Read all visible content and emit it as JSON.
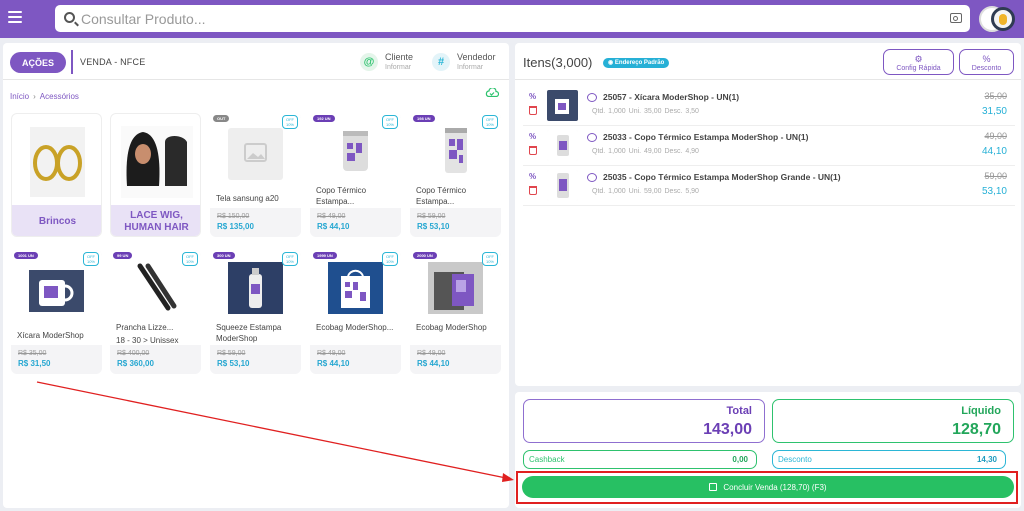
{
  "topbar": {
    "search_placeholder": "Consultar Produto..."
  },
  "left": {
    "acoes": "AÇÕES",
    "venda_type": "VENDA - NFCE",
    "cliente_label": "Cliente",
    "cliente_sub": "Informar",
    "vendedor_label": "Vendedor",
    "vendedor_sub": "Informar",
    "breadcrumb_home": "Início",
    "breadcrumb_sep": "›",
    "breadcrumb_current": "Acessórios",
    "categories": [
      {
        "name": "Brincos"
      },
      {
        "name_line1": "LACE WIG,",
        "name_line2": "HUMAN HAIR"
      }
    ],
    "products": [
      {
        "badge": "OUT",
        "off": "OFF 10%",
        "name": "Tela sansung a20",
        "old": "R$ 150,00",
        "price": "R$ 135,00"
      },
      {
        "badge": "192 UN",
        "off": "OFF 10%",
        "name": "Copo Térmico Estampa...",
        "old": "R$ 49,00",
        "price": "R$ 44,10"
      },
      {
        "badge": "198 UN",
        "off": "OFF 10%",
        "name": "Copo Térmico Estampa...",
        "old": "R$ 59,00",
        "price": "R$ 53,10"
      },
      {
        "badge": "1001 UN",
        "off": "OFF 10%",
        "name": "Xícara ModerShop",
        "old": "R$ 35,00",
        "price": "R$ 31,50"
      },
      {
        "badge": "99 UN",
        "off": "OFF 10%",
        "name": "Prancha Lizze...",
        "name2": "18 - 30 > Unissex",
        "old": "R$ 400,00",
        "price": "R$ 360,00"
      },
      {
        "badge": "300 UN",
        "off": "OFF 10%",
        "name": "Squeeze Estampa ModerShop",
        "old": "R$ 59,00",
        "price": "R$ 53,10"
      },
      {
        "badge": "1999 UN",
        "off": "OFF 10%",
        "name": "Ecobag ModerShop...",
        "old": "R$ 49,00",
        "price": "R$ 44,10"
      },
      {
        "badge": "2000 UN",
        "off": "OFF 10%",
        "name": "Ecobag ModerShop",
        "old": "R$ 49,00",
        "price": "R$ 44,10"
      }
    ]
  },
  "right": {
    "title": "Itens(3,000)",
    "address_badge": "Endereço Padrão",
    "config_label": "Config Rápida",
    "desconto_label": "Desconto",
    "items": [
      {
        "title": "25057 - Xícara ModerShop - UN(1)",
        "meta": "Qtd. 1,000  Uni. 35,00  Desc. 3,50",
        "old": "35,00",
        "price": "31,50"
      },
      {
        "title": "25033 - Copo Térmico Estampa ModerShop - UN(1)",
        "meta": "Qtd. 1,000  Uni. 49,00  Desc. 4,90",
        "old": "49,00",
        "price": "44,10"
      },
      {
        "title": "25035 - Copo Térmico Estampa ModerShop Grande - UN(1)",
        "meta": "Qtd. 1,000  Uni. 59,00  Desc. 5,90",
        "old": "59,00",
        "price": "53,10"
      }
    ]
  },
  "totals": {
    "total_label": "Total",
    "total_value": "143,00",
    "liquido_label": "Líquido",
    "liquido_value": "128,70",
    "cashback_label": "Cashback",
    "cashback_value": "0,00",
    "desconto_label": "Desconto",
    "desconto_value": "14,30",
    "concluir_label": "Concluir Venda (128,70) (F3)"
  },
  "colors": {
    "brand": "#7e57c2",
    "success": "#27c063",
    "info": "#26b0d6",
    "annotation": "#e02020"
  }
}
